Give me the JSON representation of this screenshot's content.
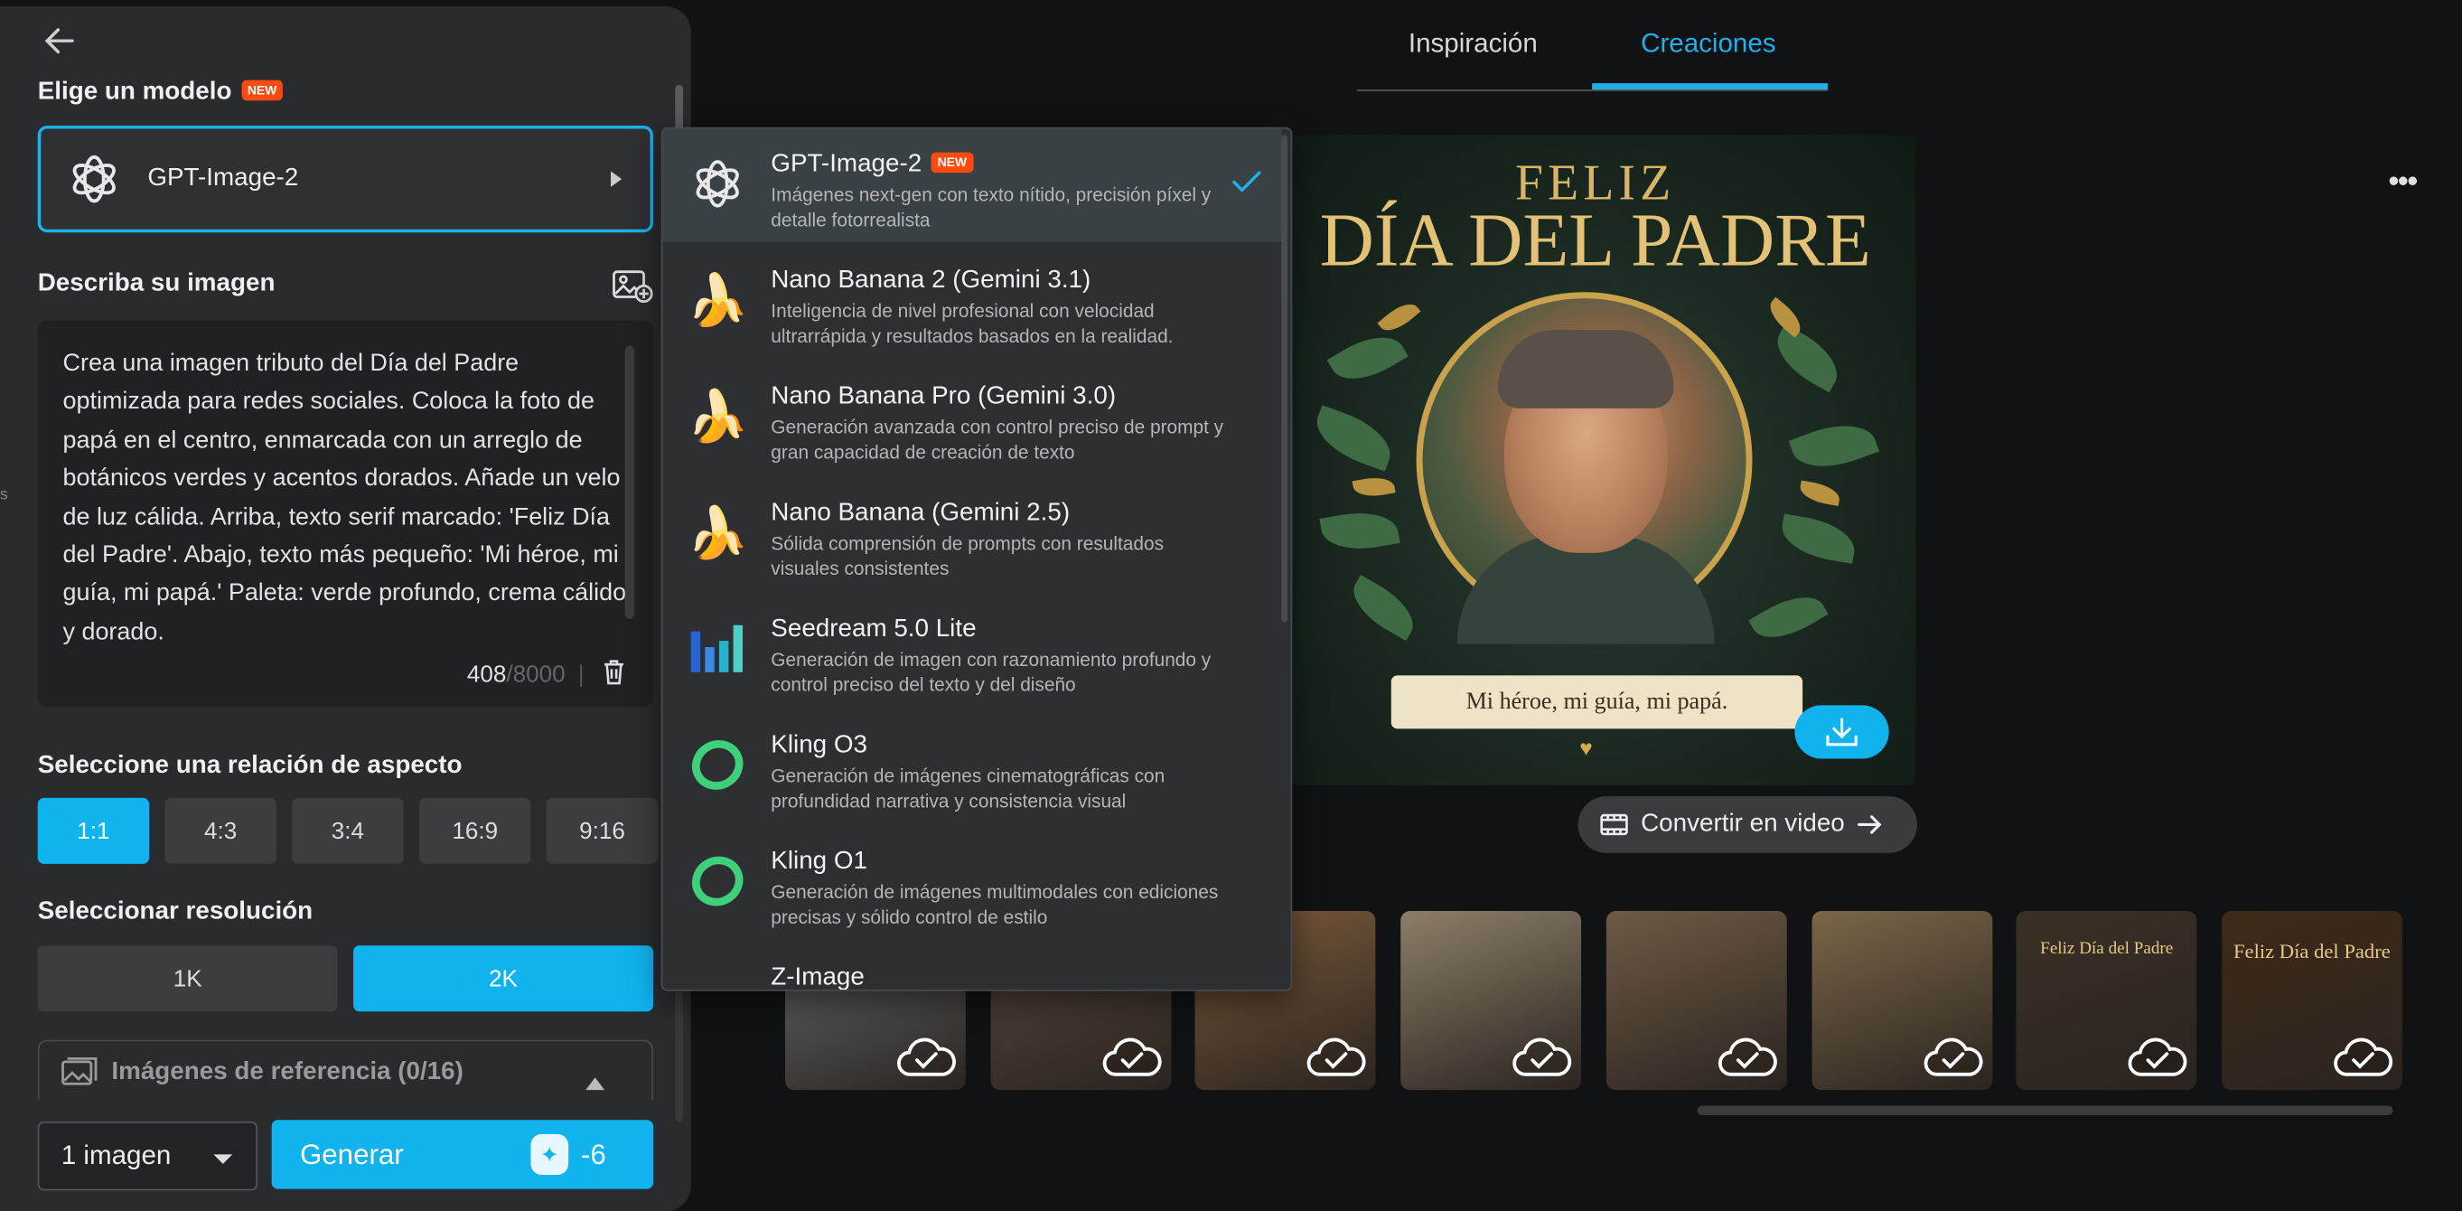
{
  "left_panel": {
    "model_label": "Elige un modelo",
    "new_badge": "NEW",
    "selected_model": "GPT-Image-2",
    "describe_label": "Describa su imagen",
    "prompt_text": "Crea una imagen tributo del Día del Padre optimizada para redes sociales. Coloca la foto de papá en el centro, enmarcada con un arreglo de botánicos verdes y acentos dorados. Añade un velo de luz cálida. Arriba, texto serif marcado: 'Feliz Día del Padre'. Abajo, texto más pequeño: 'Mi héroe, mi guía, mi papá.' Paleta: verde profundo, crema cálido y dorado.",
    "char_count": "408",
    "char_max": "/8000",
    "char_sep": "|",
    "aspect_label": "Seleccione una relación de aspecto",
    "aspect_ratios": [
      "1:1",
      "4:3",
      "3:4",
      "16:9",
      "9:16"
    ],
    "resolution_label": "Seleccionar resolución",
    "resolutions": [
      "1K",
      "2K"
    ],
    "reference_label": "Imágenes de referencia (0/16)",
    "image_count": "1 imagen",
    "generate_label": "Generar",
    "credit_cost": "-6",
    "edge_text": "s"
  },
  "dropdown": {
    "items": [
      {
        "name": "GPT-Image-2",
        "badge": "NEW",
        "desc": "Imágenes next-gen con texto nítido, precisión píxel y detalle fotorrealista",
        "icon": "openai-icon"
      },
      {
        "name": "Nano Banana 2 (Gemini 3.1)",
        "desc": "Inteligencia de nivel profesional con velocidad ultrarrápida y resultados basados en la realidad.",
        "icon": "banana-icon"
      },
      {
        "name": "Nano Banana Pro (Gemini 3.0)",
        "desc": "Generación avanzada con control preciso de prompt y gran capacidad de creación de texto",
        "icon": "banana-icon"
      },
      {
        "name": "Nano Banana (Gemini 2.5)",
        "desc": "Sólida comprensión de prompts con resultados visuales consistentes",
        "icon": "banana-icon"
      },
      {
        "name": "Seedream 5.0 Lite",
        "desc": "Generación de imagen con razonamiento profundo y control preciso del texto y del diseño",
        "icon": "seedream-icon"
      },
      {
        "name": "Kling O3",
        "desc": "Generación de imágenes cinematográficas con profundidad narrativa y consistencia visual",
        "icon": "kling-icon"
      },
      {
        "name": "Kling O1",
        "desc": "Generación de imágenes multimodales con ediciones precisas y sólido control de estilo",
        "icon": "kling-icon"
      },
      {
        "name": "Z-Image",
        "desc": "",
        "icon": "z-image-icon"
      }
    ]
  },
  "tabs": [
    "Inspiración",
    "Creaciones"
  ],
  "poster": {
    "line1": "FELIZ",
    "line2": "DÍA DEL PADRE",
    "ribbon": "Mi héroe, mi guía, mi papá."
  },
  "convert_label": "Convertir en video",
  "thumbnails": [
    {
      "bg": "#6b6e72",
      "text": ""
    },
    {
      "bg": "#5a4a3c",
      "text": ""
    },
    {
      "bg": "#7c5a3a",
      "text": ""
    },
    {
      "bg": "#8c7e68",
      "text": ""
    },
    {
      "bg": "#6e5a44",
      "text": ""
    },
    {
      "bg": "#7a6648",
      "text": ""
    },
    {
      "bg": "#3a3024",
      "text": "Feliz Día del Padre"
    },
    {
      "bg": "#3e2a18",
      "text": "Feliz Día del Padre"
    }
  ],
  "colors": {
    "accent": "#10b3ee",
    "badge": "#ff4b12",
    "gold": "#d9b667"
  }
}
